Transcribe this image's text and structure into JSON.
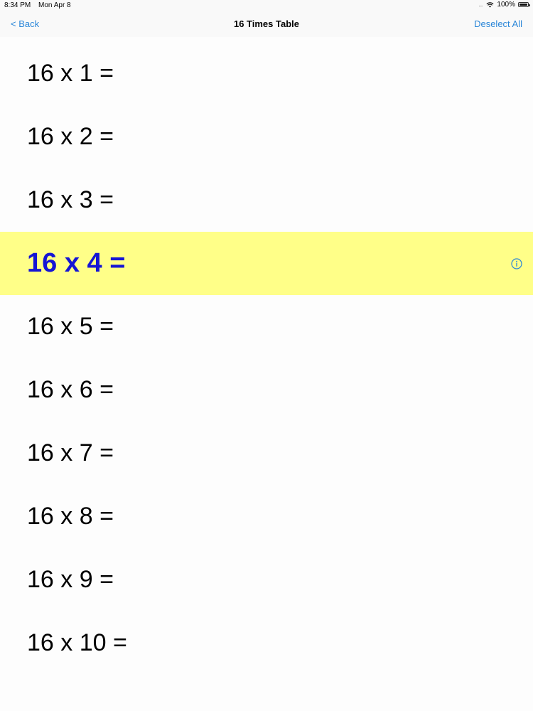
{
  "status_bar": {
    "time": "8:34 PM",
    "date": "Mon Apr 8",
    "battery": "100%"
  },
  "nav": {
    "back_label": "< Back",
    "title": "16 Times Table",
    "action_label": "Deselect All"
  },
  "rows": [
    {
      "label": "16 x 1 ="
    },
    {
      "label": "16 x 2 ="
    },
    {
      "label": "16 x 3 ="
    },
    {
      "label": "16 x 4 ="
    },
    {
      "label": "16 x 5 ="
    },
    {
      "label": "16 x 6 ="
    },
    {
      "label": "16 x 7 ="
    },
    {
      "label": "16 x 8 ="
    },
    {
      "label": "16 x 9 ="
    },
    {
      "label": "16 x 10 ="
    }
  ],
  "selected_row": "16 x 4 =",
  "colors": {
    "accent": "#2a86d8",
    "selected_background": "#ffff88",
    "selected_text": "#1515d4"
  },
  "icons": {
    "selected_row_icon": "info-icon"
  }
}
